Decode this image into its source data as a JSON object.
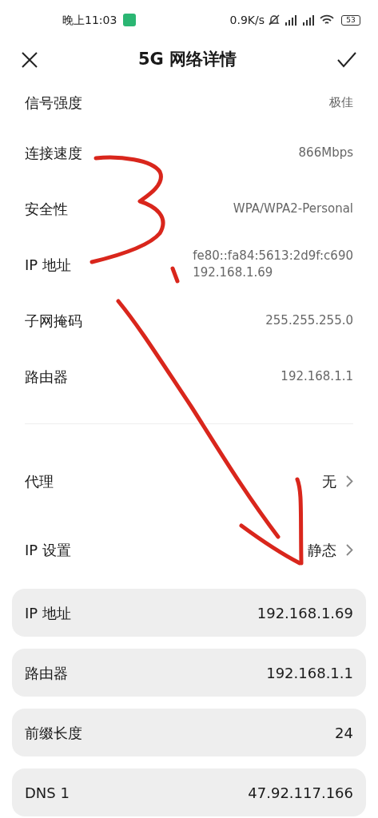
{
  "status_bar": {
    "time": "晚上11:03",
    "speed": "0.9K/s",
    "battery": "53"
  },
  "header": {
    "title": "5G 网络详情"
  },
  "info_rows": [
    {
      "label": "信号强度",
      "values": [
        "极佳"
      ]
    },
    {
      "label": "连接速度",
      "values": [
        "866Mbps"
      ]
    },
    {
      "label": "安全性",
      "values": [
        "WPA/WPA2-Personal"
      ]
    },
    {
      "label": "IP 地址",
      "values": [
        "fe80::fa84:5613:2d9f:c690",
        "192.168.1.69"
      ]
    },
    {
      "label": "子网掩码",
      "values": [
        "255.255.255.0"
      ]
    },
    {
      "label": "路由器",
      "values": [
        "192.168.1.1"
      ]
    }
  ],
  "settings_rows": [
    {
      "label": "代理",
      "value": "无"
    },
    {
      "label": "IP 设置",
      "value": "静态"
    }
  ],
  "fields": [
    {
      "label": "IP 地址",
      "value": "192.168.1.69"
    },
    {
      "label": "路由器",
      "value": "192.168.1.1"
    },
    {
      "label": "前缀长度",
      "value": "24"
    },
    {
      "label": "DNS 1",
      "value": "47.92.117.166"
    }
  ]
}
